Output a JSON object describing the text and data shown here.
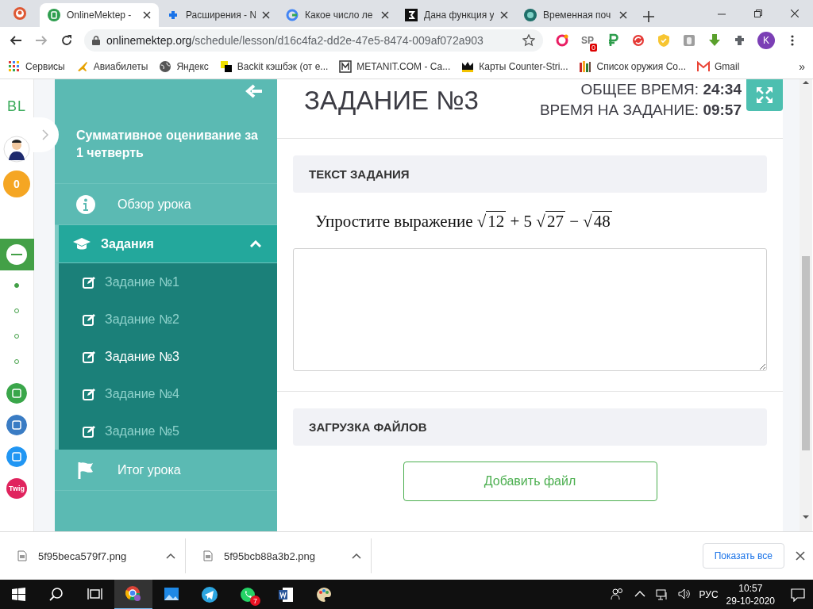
{
  "browser": {
    "tabs": [
      {
        "title": "OnlineMektep -",
        "selected": true
      },
      {
        "title": "Расширения - N",
        "selected": false
      },
      {
        "title": "Какое число ле",
        "selected": false
      },
      {
        "title": "Дана функция у",
        "selected": false
      },
      {
        "title": "Временная поч",
        "selected": false
      }
    ],
    "address": {
      "host": "onlinemektep.org",
      "path": "/schedule/lesson/d16c4fa2-dd2e-47e5-8474-009af072a903"
    },
    "extension_badge": "0",
    "extension_label": "SP",
    "profile_initial": "K",
    "bookmarks": [
      "Сервисы",
      "Авиабилеты",
      "Яндекс",
      "Backit кэшбэк (от е...",
      "METANIT.COM - Са...",
      "Карты Counter-Stri...",
      "Список оружия Co...",
      "Gmail"
    ],
    "bookmarks_more": "»"
  },
  "rail": {
    "logo": "BL",
    "points": "0",
    "steps": [
      {
        "selected": true
      },
      {
        "selected": false
      },
      {
        "selected": false
      },
      {
        "selected": false
      }
    ],
    "app_label": "Twig"
  },
  "sidebar": {
    "title": "Суммативное оценивание за 1 четверть",
    "items": [
      {
        "kind": "info",
        "label": "Обзор урока",
        "expanded": false
      },
      {
        "kind": "tasks",
        "label": "Задания",
        "expanded": true,
        "children": [
          {
            "label": "Задание №1",
            "selected": false
          },
          {
            "label": "Задание №2",
            "selected": false
          },
          {
            "label": "Задание №3",
            "selected": true
          },
          {
            "label": "Задание №4",
            "selected": false
          },
          {
            "label": "Задание №5",
            "selected": false
          }
        ]
      },
      {
        "kind": "flag",
        "label": "Итог урока",
        "expanded": false
      }
    ]
  },
  "task": {
    "title": "ЗАДАНИЕ №3",
    "total_time": "ОБЩЕЕ ВРЕМЯ: **24:34**",
    "task_time": "ВРЕМЯ НА ЗАДАНИЕ: **09:57**",
    "text_heading": "ТЕКСТ ЗАДАНИЯ",
    "statement": "Упростите выражение",
    "expression": [
      {
        "kind": "root",
        "sign": "√",
        "radicand": "12"
      },
      {
        "kind": "op",
        "text": "+ 5"
      },
      {
        "kind": "root",
        "sign": "√",
        "radicand": "27"
      },
      {
        "kind": "op",
        "text": "−"
      },
      {
        "kind": "root",
        "sign": "√",
        "radicand": "48"
      }
    ],
    "files_heading": "ЗАГРУЗКА ФАЙЛОВ",
    "add_file_button": "Добавить файл"
  },
  "downloads": {
    "items": [
      "5f95beca579f7.png",
      "5f95bcb88a3b2.png"
    ],
    "show_all": "Показать все"
  },
  "taskbar": {
    "whatsapp_badge": "7",
    "language": "РУС",
    "time": "10:57",
    "date": "29-10-2020"
  }
}
